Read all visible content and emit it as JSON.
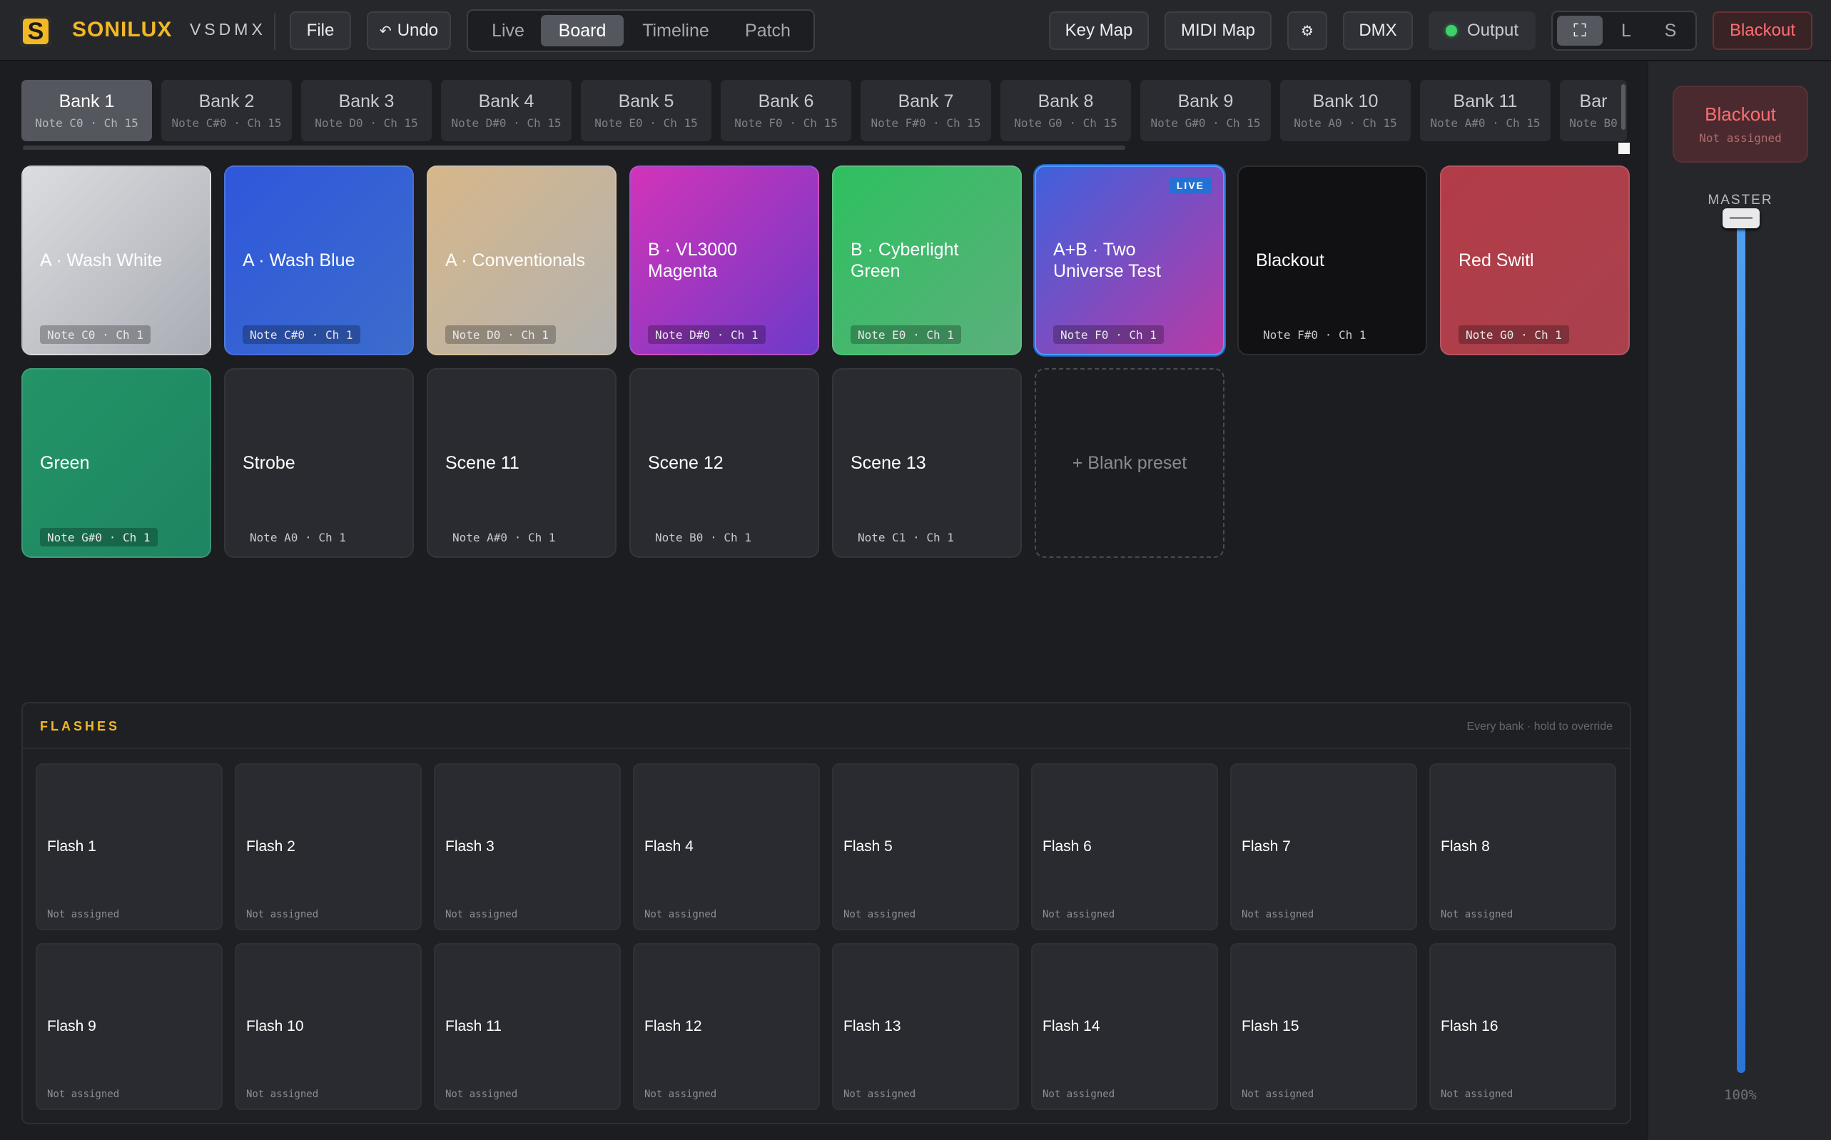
{
  "app": {
    "brand": "SONILUX",
    "product": "VSDMX",
    "logo_letter": "S"
  },
  "toolbar": {
    "file": "File",
    "undo": "Undo",
    "undo_icon": "↶",
    "views": [
      "Live",
      "Board",
      "Timeline",
      "Patch"
    ],
    "active_view": "Board",
    "key_map": "Key Map",
    "midi_map": "MIDI Map",
    "settings_icon": "⚙",
    "dmx": "DMX",
    "output": "Output",
    "output_status_color": "#3ed16b",
    "size_modes": [
      "⛶",
      "L",
      "S"
    ],
    "blackout": "Blackout"
  },
  "banks": [
    {
      "name": "Bank 1",
      "sub": "Note C0 · Ch 15",
      "active": true
    },
    {
      "name": "Bank 2",
      "sub": "Note C#0 · Ch 15"
    },
    {
      "name": "Bank 3",
      "sub": "Note D0 · Ch 15"
    },
    {
      "name": "Bank 4",
      "sub": "Note D#0 · Ch 15"
    },
    {
      "name": "Bank 5",
      "sub": "Note E0 · Ch 15"
    },
    {
      "name": "Bank 6",
      "sub": "Note F0 · Ch 15"
    },
    {
      "name": "Bank 7",
      "sub": "Note F#0 · Ch 15"
    },
    {
      "name": "Bank 8",
      "sub": "Note G0 · Ch 15"
    },
    {
      "name": "Bank 9",
      "sub": "Note G#0 · Ch 15"
    },
    {
      "name": "Bank 10",
      "sub": "Note A0 · Ch 15"
    },
    {
      "name": "Bank 11",
      "sub": "Note A#0 · Ch 15"
    },
    {
      "name": "Bar",
      "sub": "Note B0"
    }
  ],
  "presets": [
    {
      "name": "A · Wash White",
      "note": "Note C0 · Ch 1",
      "bg": "linear-gradient(135deg,#dcdde0,#a9acb4)"
    },
    {
      "name": "A · Wash Blue",
      "note": "Note C#0 · Ch 1",
      "bg": "linear-gradient(135deg,#2f57dc,#3b6ccc)"
    },
    {
      "name": "A · Conventionals",
      "note": "Note D0 · Ch 1",
      "bg": "linear-gradient(135deg,#d7b789,#b3b2b0)"
    },
    {
      "name": "B · VL3000 Magenta",
      "note": "Note D#0 · Ch 1",
      "bg": "linear-gradient(135deg,#d234b8,#6d3ac9)"
    },
    {
      "name": "B · Cyberlight Green",
      "note": "Note E0 · Ch 1",
      "bg": "linear-gradient(135deg,#2ec05f,#5bb07c)"
    },
    {
      "name": "A+B · Two Universe Test",
      "note": "Note F0 · Ch 1",
      "bg": "linear-gradient(135deg,#3f61dc,#b83aa6)",
      "live": "LIVE"
    },
    {
      "name": "Blackout",
      "note": "Note F#0 · Ch 1",
      "bg": "#111113",
      "dark": true
    },
    {
      "name": "Red Switl",
      "note": "Note G0 · Ch 1",
      "bg": "linear-gradient(135deg,#b23c47,#a9414d)"
    },
    {
      "name": "Green",
      "note": "Note G#0 · Ch 1",
      "bg": "linear-gradient(135deg,#239466,#1e8562)"
    },
    {
      "name": "Strobe",
      "note": "Note A0 · Ch 1",
      "dark": true
    },
    {
      "name": "Scene 11",
      "note": "Note A#0 · Ch 1",
      "dark": true
    },
    {
      "name": "Scene 12",
      "note": "Note B0 · Ch 1",
      "dark": true
    },
    {
      "name": "Scene 13",
      "note": "Note C1 · Ch 1",
      "dark": true
    }
  ],
  "blank_preset": "+ Blank preset",
  "flashes": {
    "title": "FLASHES",
    "hint": "Every bank · hold to override",
    "items": [
      {
        "name": "Flash 1",
        "sub": "Not assigned"
      },
      {
        "name": "Flash 2",
        "sub": "Not assigned"
      },
      {
        "name": "Flash 3",
        "sub": "Not assigned"
      },
      {
        "name": "Flash 4",
        "sub": "Not assigned"
      },
      {
        "name": "Flash 5",
        "sub": "Not assigned"
      },
      {
        "name": "Flash 6",
        "sub": "Not assigned"
      },
      {
        "name": "Flash 7",
        "sub": "Not assigned"
      },
      {
        "name": "Flash 8",
        "sub": "Not assigned"
      },
      {
        "name": "Flash 9",
        "sub": "Not assigned"
      },
      {
        "name": "Flash 10",
        "sub": "Not assigned"
      },
      {
        "name": "Flash 11",
        "sub": "Not assigned"
      },
      {
        "name": "Flash 12",
        "sub": "Not assigned"
      },
      {
        "name": "Flash 13",
        "sub": "Not assigned"
      },
      {
        "name": "Flash 14",
        "sub": "Not assigned"
      },
      {
        "name": "Flash 15",
        "sub": "Not assigned"
      },
      {
        "name": "Flash 16",
        "sub": "Not assigned"
      }
    ]
  },
  "sidebar": {
    "blackout_label": "Blackout",
    "blackout_sub": "Not assigned",
    "master_label": "MASTER",
    "master_value": "100%",
    "master_level": 1.0
  }
}
